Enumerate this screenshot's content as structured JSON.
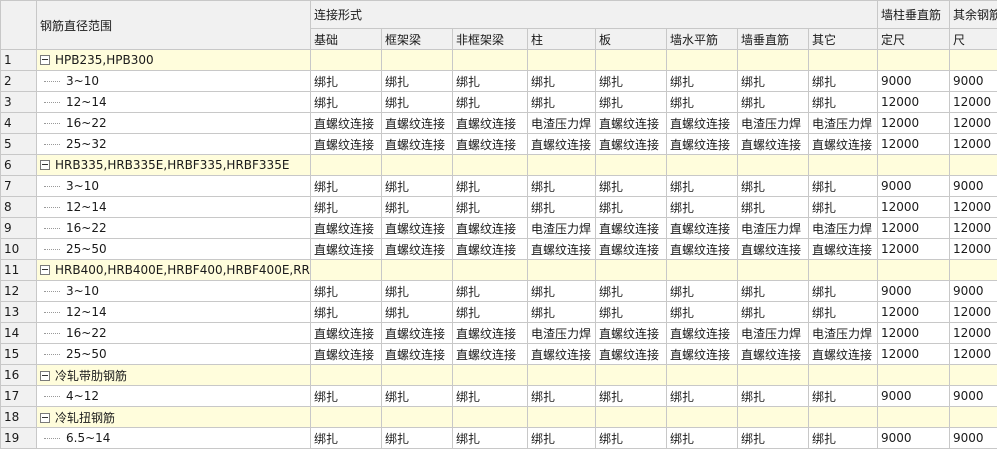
{
  "header": {
    "range_title": "钢筋直径范围",
    "conn_title": "连接形式",
    "cols": [
      "基础",
      "框架梁",
      "非框架梁",
      "柱",
      "板",
      "墙水平筋",
      "墙垂直筋",
      "其它"
    ],
    "col_wall_fixed": [
      "墙柱垂直筋",
      "定尺"
    ],
    "col_other_fixed": [
      "其余钢筋",
      "尺"
    ]
  },
  "rows": [
    {
      "no": "1",
      "group": true,
      "label": "HPB235,HPB300"
    },
    {
      "no": "2",
      "group": false,
      "label": "3~10",
      "cells": [
        "绑扎",
        "绑扎",
        "绑扎",
        "绑扎",
        "绑扎",
        "绑扎",
        "绑扎",
        "绑扎",
        "9000",
        "9000"
      ]
    },
    {
      "no": "3",
      "group": false,
      "label": "12~14",
      "cells": [
        "绑扎",
        "绑扎",
        "绑扎",
        "绑扎",
        "绑扎",
        "绑扎",
        "绑扎",
        "绑扎",
        "12000",
        "12000"
      ]
    },
    {
      "no": "4",
      "group": false,
      "label": "16~22",
      "cells": [
        "直螺纹连接",
        "直螺纹连接",
        "直螺纹连接",
        "电渣压力焊",
        "直螺纹连接",
        "直螺纹连接",
        "电渣压力焊",
        "电渣压力焊",
        "12000",
        "12000"
      ]
    },
    {
      "no": "5",
      "group": false,
      "label": "25~32",
      "cells": [
        "直螺纹连接",
        "直螺纹连接",
        "直螺纹连接",
        "直螺纹连接",
        "直螺纹连接",
        "直螺纹连接",
        "直螺纹连接",
        "直螺纹连接",
        "12000",
        "12000"
      ]
    },
    {
      "no": "6",
      "group": true,
      "label": "HRB335,HRB335E,HRBF335,HRBF335E"
    },
    {
      "no": "7",
      "group": false,
      "label": "3~10",
      "cells": [
        "绑扎",
        "绑扎",
        "绑扎",
        "绑扎",
        "绑扎",
        "绑扎",
        "绑扎",
        "绑扎",
        "9000",
        "9000"
      ]
    },
    {
      "no": "8",
      "group": false,
      "label": "12~14",
      "cells": [
        "绑扎",
        "绑扎",
        "绑扎",
        "绑扎",
        "绑扎",
        "绑扎",
        "绑扎",
        "绑扎",
        "12000",
        "12000"
      ]
    },
    {
      "no": "9",
      "group": false,
      "label": "16~22",
      "cells": [
        "直螺纹连接",
        "直螺纹连接",
        "直螺纹连接",
        "电渣压力焊",
        "直螺纹连接",
        "直螺纹连接",
        "电渣压力焊",
        "电渣压力焊",
        "12000",
        "12000"
      ]
    },
    {
      "no": "10",
      "group": false,
      "label": "25~50",
      "cells": [
        "直螺纹连接",
        "直螺纹连接",
        "直螺纹连接",
        "直螺纹连接",
        "直螺纹连接",
        "直螺纹连接",
        "直螺纹连接",
        "直螺纹连接",
        "12000",
        "12000"
      ]
    },
    {
      "no": "11",
      "group": true,
      "label": "HRB400,HRB400E,HRBF400,HRBF400E,RR..."
    },
    {
      "no": "12",
      "group": false,
      "label": "3~10",
      "cells": [
        "绑扎",
        "绑扎",
        "绑扎",
        "绑扎",
        "绑扎",
        "绑扎",
        "绑扎",
        "绑扎",
        "9000",
        "9000"
      ]
    },
    {
      "no": "13",
      "group": false,
      "label": "12~14",
      "cells": [
        "绑扎",
        "绑扎",
        "绑扎",
        "绑扎",
        "绑扎",
        "绑扎",
        "绑扎",
        "绑扎",
        "12000",
        "12000"
      ]
    },
    {
      "no": "14",
      "group": false,
      "label": "16~22",
      "cells": [
        "直螺纹连接",
        "直螺纹连接",
        "直螺纹连接",
        "电渣压力焊",
        "直螺纹连接",
        "直螺纹连接",
        "电渣压力焊",
        "电渣压力焊",
        "12000",
        "12000"
      ]
    },
    {
      "no": "15",
      "group": false,
      "label": "25~50",
      "cells": [
        "直螺纹连接",
        "直螺纹连接",
        "直螺纹连接",
        "直螺纹连接",
        "直螺纹连接",
        "直螺纹连接",
        "直螺纹连接",
        "直螺纹连接",
        "12000",
        "12000"
      ]
    },
    {
      "no": "16",
      "group": true,
      "label": "冷轧带肋钢筋"
    },
    {
      "no": "17",
      "group": false,
      "label": "4~12",
      "cells": [
        "绑扎",
        "绑扎",
        "绑扎",
        "绑扎",
        "绑扎",
        "绑扎",
        "绑扎",
        "绑扎",
        "9000",
        "9000"
      ]
    },
    {
      "no": "18",
      "group": true,
      "label": "冷轧扭钢筋"
    },
    {
      "no": "19",
      "group": false,
      "label": "6.5~14",
      "cells": [
        "绑扎",
        "绑扎",
        "绑扎",
        "绑扎",
        "绑扎",
        "绑扎",
        "绑扎",
        "绑扎",
        "9000",
        "9000"
      ]
    }
  ]
}
